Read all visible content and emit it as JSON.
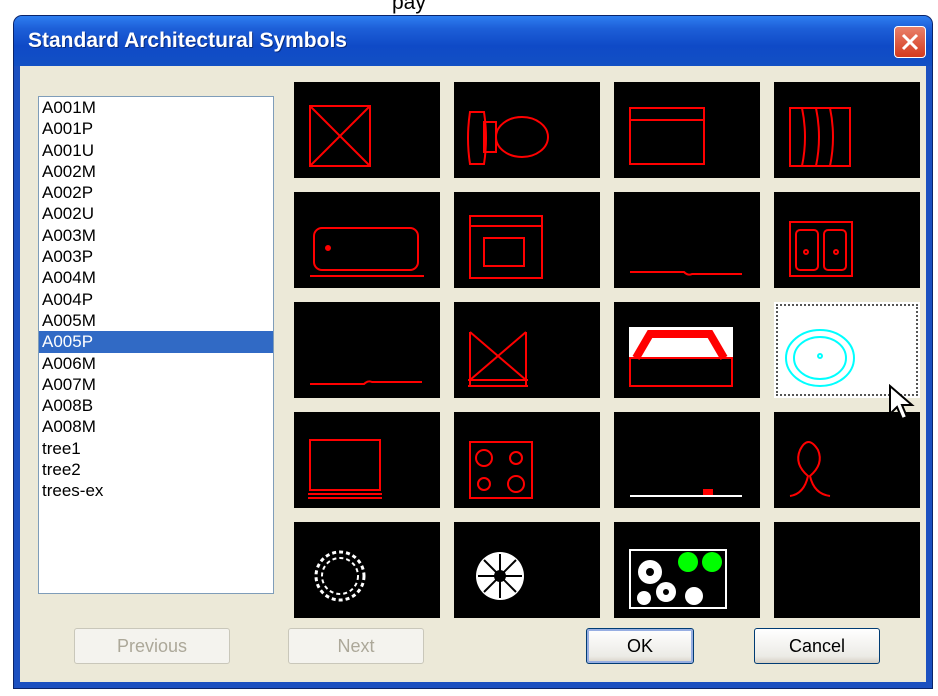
{
  "top_strip_text": "pay",
  "window": {
    "title": "Standard Architectural Symbols"
  },
  "list": {
    "items": [
      "A001M",
      "A001P",
      "A001U",
      "A002M",
      "A002P",
      "A002U",
      "A003M",
      "A003P",
      "A004M",
      "A004P",
      "A005M",
      "A005P",
      "A006M",
      "A007M",
      "A008B",
      "A008M",
      "tree1",
      "tree2",
      "trees-ex"
    ],
    "selected": "A005P"
  },
  "buttons": {
    "previous": "Previous",
    "next": "Next",
    "ok": "OK",
    "cancel": "Cancel"
  },
  "colors": {
    "symbol_stroke": "#ff0000",
    "selected_symbol_stroke": "#00ffff",
    "tree_fill": "#ffffff",
    "tree_accent": "#00ff00",
    "selection_highlight": "#316ac5"
  }
}
